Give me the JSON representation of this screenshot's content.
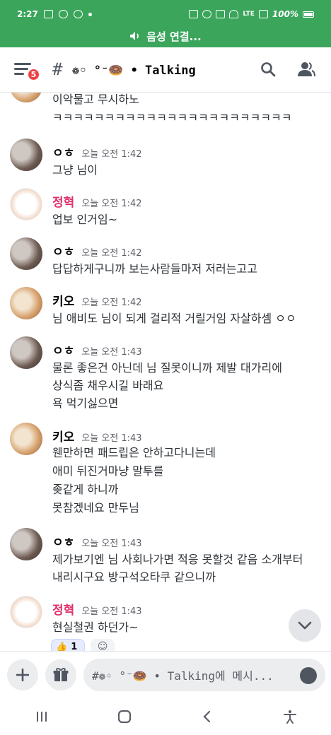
{
  "status_bar": {
    "time": "2:27",
    "network": "LTE",
    "battery": "100%"
  },
  "voice_banner": {
    "label": "음성 연결..."
  },
  "header": {
    "notification_count": "5",
    "hash": "#",
    "channel_name": "❁◦ °⁻🍩 • Talking"
  },
  "messages": [
    {
      "lines": [
        "이악물고 무시하노",
        "ㅋㅋㅋㅋㅋㅋㅋㅋㅋㅋㅋㅋㅋㅋㅋㅋㅋㅋㅋㅋㅋㅋㅋ"
      ]
    },
    {
      "author": "ㅇㅎ",
      "time": "오늘 오전 1:42",
      "lines": [
        "그냥 님이"
      ]
    },
    {
      "author": "정혁",
      "time": "오늘 오전 1:42",
      "lines": [
        "업보 인거임~"
      ]
    },
    {
      "author": "ㅇㅎ",
      "time": "오늘 오전 1:42",
      "lines": [
        "답답하게구니까 보는사람들마저 저러는고고"
      ]
    },
    {
      "author": "키오",
      "time": "오늘 오전 1:42",
      "lines": [
        "님 애비도 님이 되게 걸리적 거릴거임 자살하셈 ㅇㅇ"
      ]
    },
    {
      "author": "ㅇㅎ",
      "time": "오늘 오전 1:43",
      "lines": [
        "물론 좋은건 아닌데 님 질못이니까 제발 대가리에",
        "상식좀 채우시길 바래요",
        "욕 먹기싫으면"
      ]
    },
    {
      "author": "키오",
      "time": "오늘 오전 1:43",
      "lines": [
        "웬만하면 패드립은 안하고다니는데",
        "애미 뒤진거마냥 말투를",
        "좆같게 하니까",
        "못참겠네요 만두님"
      ]
    },
    {
      "author": "ㅇㅎ",
      "time": "오늘 오전 1:43",
      "lines": [
        "제가보기엔 님 사회나가면 적응 못할것 같음 소개부터",
        "내리시구요 방구석오타쿠 같으니까"
      ]
    },
    {
      "author": "정혁",
      "time": "오늘 오전 1:43",
      "lines": [
        "현실철권 하던가~"
      ]
    }
  ],
  "reaction": {
    "emoji": "👍",
    "count": "1"
  },
  "input": {
    "placeholder": "#❁◦ °⁻🍩 • Talking에 메시..."
  },
  "colors": {
    "banner": "#3ba55c",
    "badge": "#ed4245",
    "pink_author": "#e0316b"
  }
}
